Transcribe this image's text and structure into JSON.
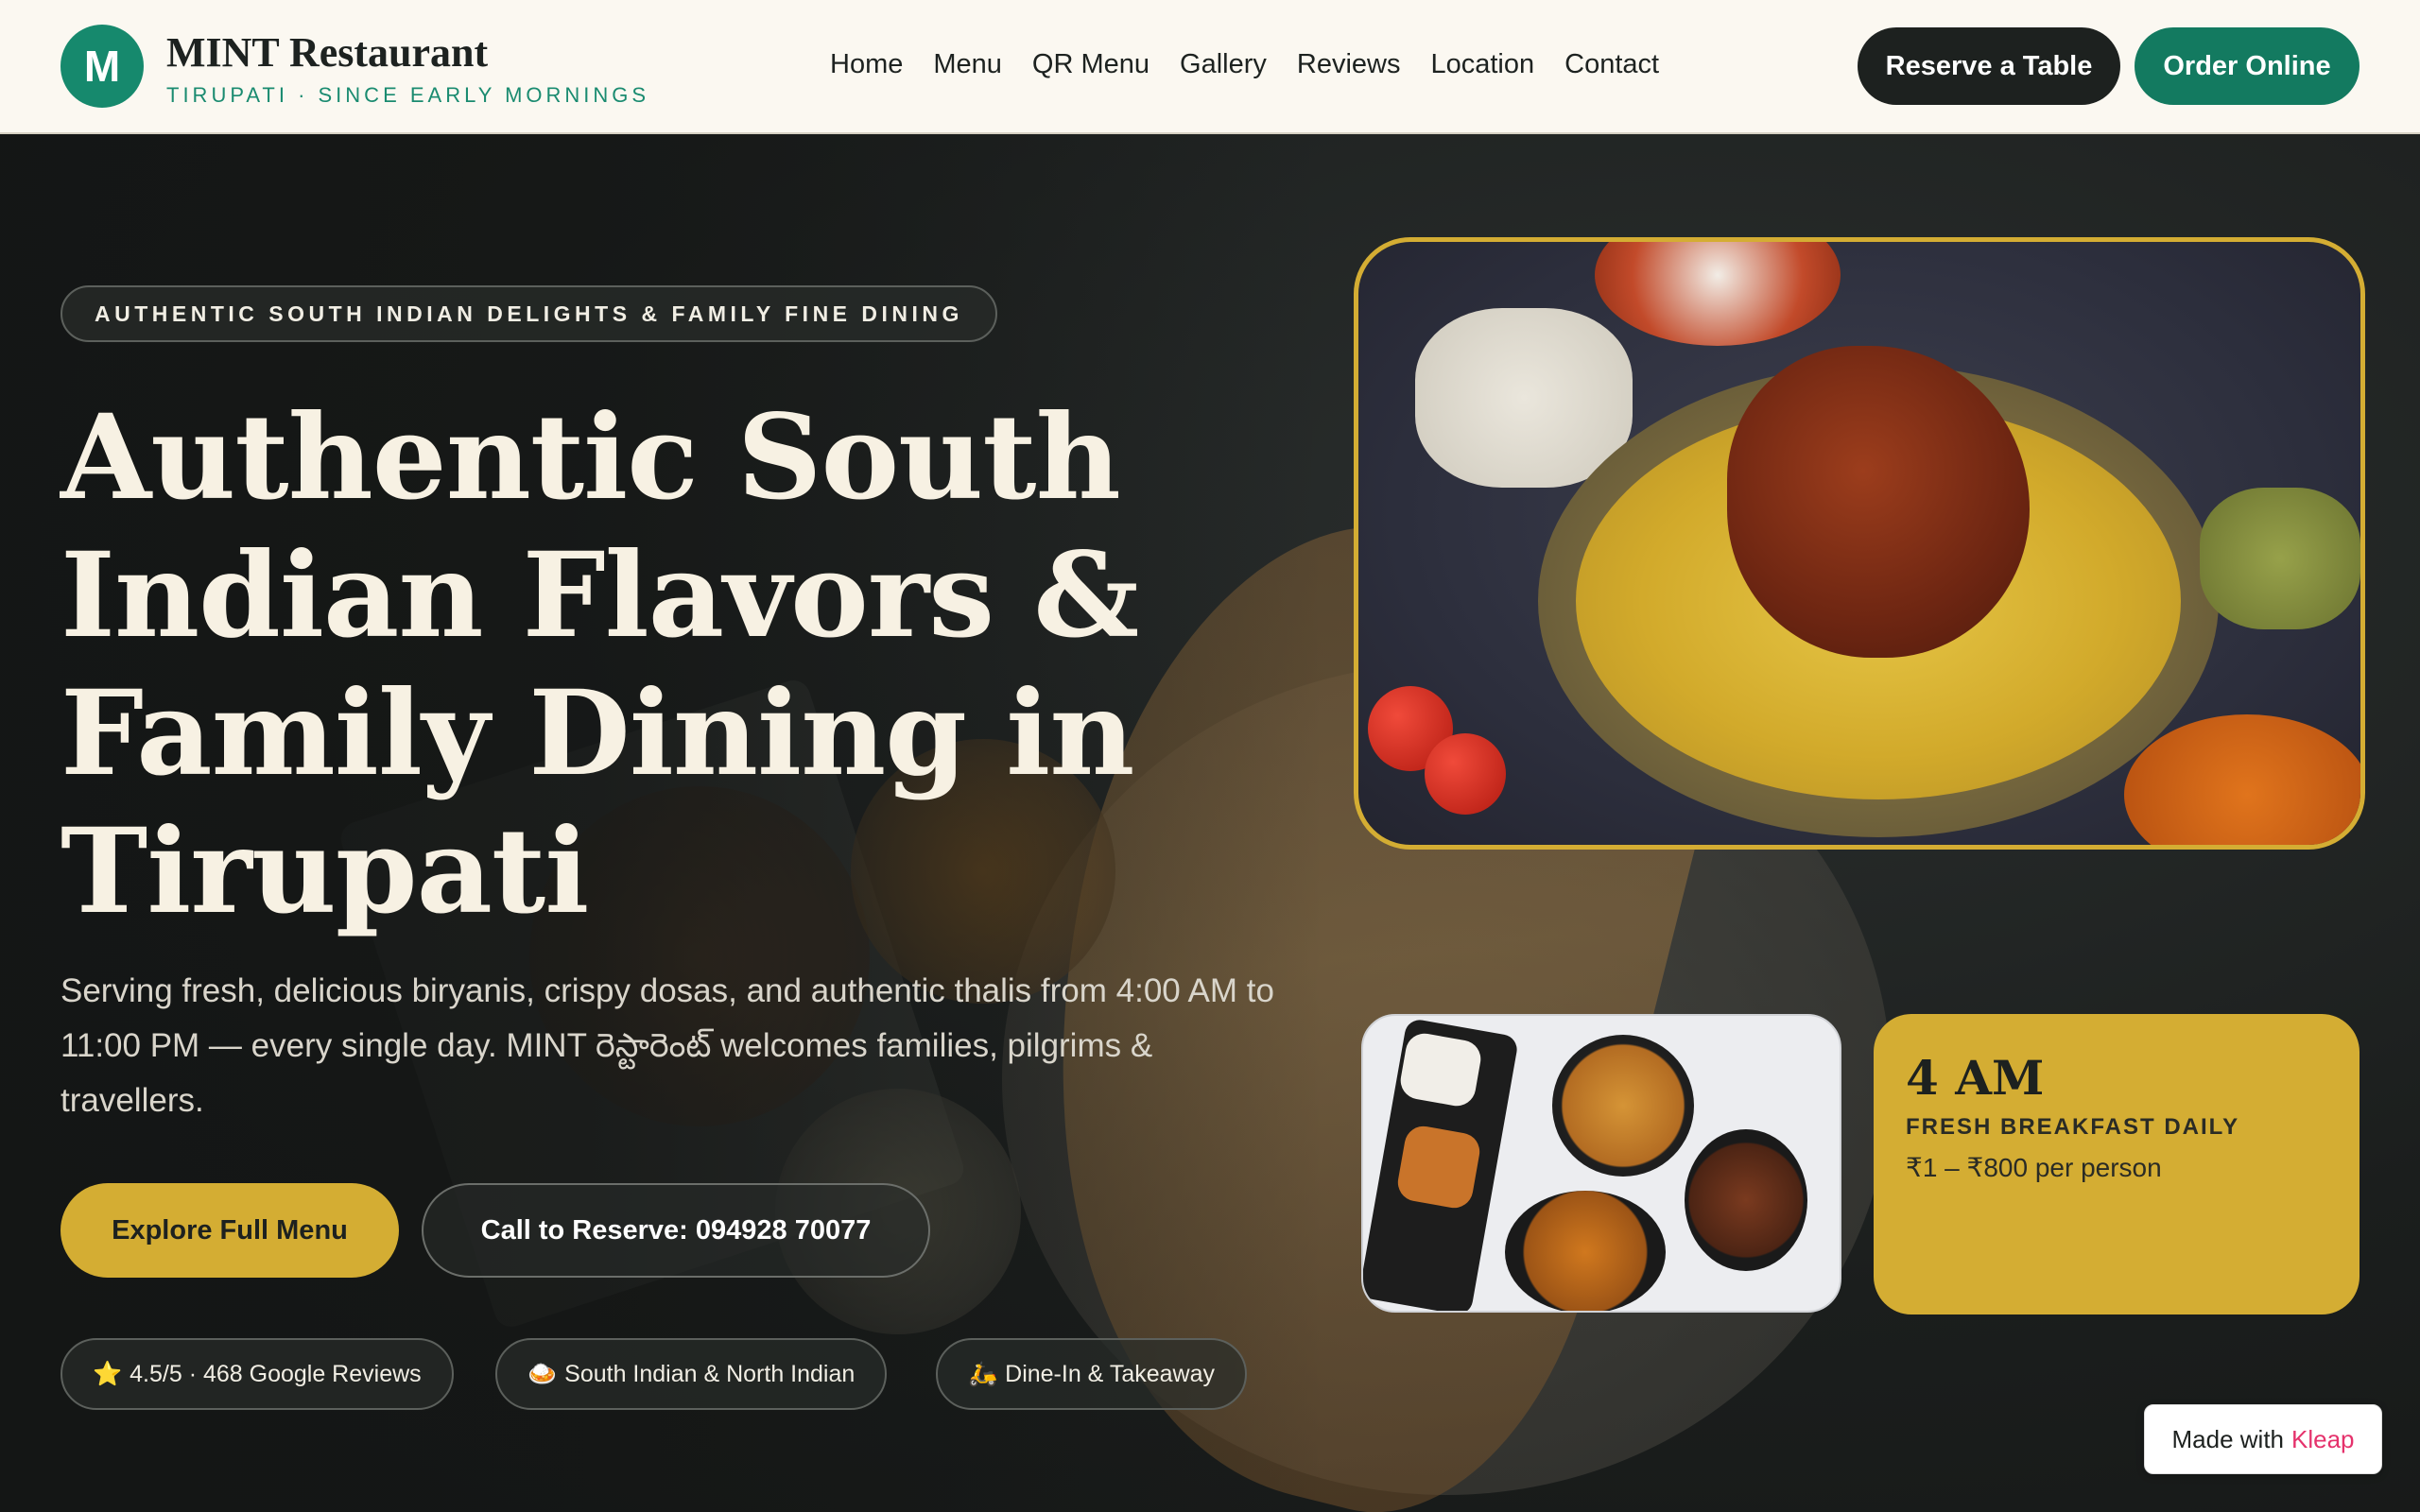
{
  "header": {
    "logo_letter": "M",
    "brand_name": "MINT Restaurant",
    "brand_tagline": "TIRUPATI · SINCE EARLY MORNINGS",
    "nav": [
      "Home",
      "Menu",
      "QR Menu",
      "Gallery",
      "Reviews",
      "Location",
      "Contact"
    ],
    "reserve_label": "Reserve a Table",
    "order_label": "Order Online"
  },
  "hero": {
    "eyebrow": "AUTHENTIC SOUTH INDIAN DELIGHTS & FAMILY FINE DINING",
    "title": "Authentic South Indian Flavors & Family Dining in Tirupati",
    "subtitle": "Serving fresh, delicious biryanis, crispy dosas, and authentic thalis from 4:00 AM to 11:00 PM — every single day. MINT రెస్టారెంట్ welcomes families, pilgrims & travellers.",
    "menu_button": "Explore Full Menu",
    "call_button": "Call to Reserve: 094928 70077",
    "chips": [
      {
        "icon": "star-icon",
        "glyph": "⭐",
        "text": "4.5/5 · 468 Google Reviews"
      },
      {
        "icon": "food-bowl-icon",
        "glyph": "🍛",
        "text": "South Indian & North Indian"
      },
      {
        "icon": "scooter-icon",
        "glyph": "🛵",
        "text": "Dine-In & Takeaway"
      }
    ]
  },
  "info_card": {
    "time": "4 AM",
    "label": "FRESH BREAKFAST DAILY",
    "price": "₹1 – ₹800 per person"
  },
  "badge": {
    "prefix": "Made with",
    "brand": "Kleap"
  },
  "colors": {
    "accent_green": "#137a60",
    "accent_gold": "#d4ad33",
    "dark": "#1d211f",
    "header_bg": "#fbf8f1"
  }
}
